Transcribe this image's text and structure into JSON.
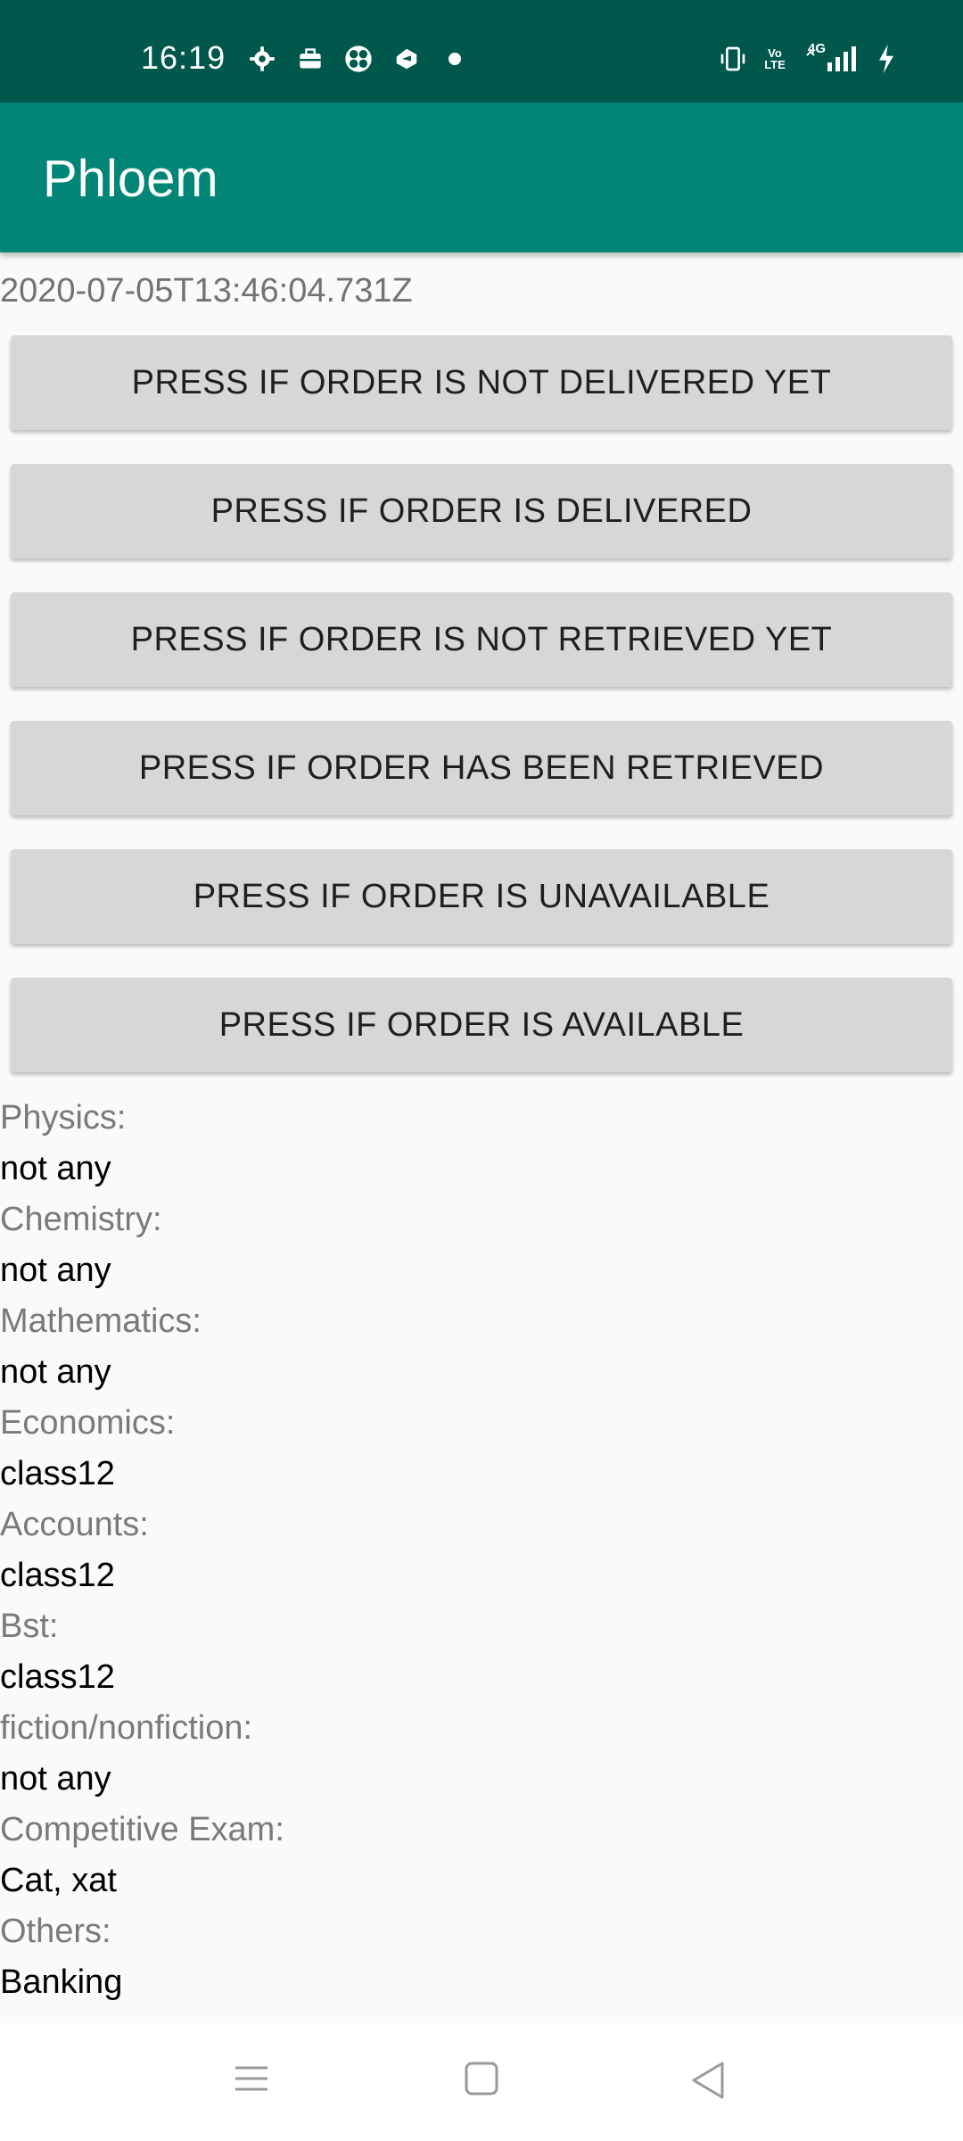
{
  "status_bar": {
    "time": "16:19",
    "left_icons": [
      "settings-icon",
      "briefcase-icon",
      "fan-icon",
      "drive-icon",
      "dot-icon"
    ],
    "right_icons": [
      "vibrate-icon",
      "volte-icon",
      "signal-4g-icon",
      "charging-icon"
    ],
    "volte_label": "Vo LTE",
    "network_label": "4G"
  },
  "app_bar": {
    "title": "Phloem"
  },
  "timestamp": "2020-07-05T13:46:04.731Z",
  "buttons": [
    {
      "label": "PRESS IF ORDER IS NOT DELIVERED YET"
    },
    {
      "label": "PRESS IF ORDER IS DELIVERED"
    },
    {
      "label": "PRESS IF ORDER IS NOT RETRIEVED YET"
    },
    {
      "label": "PRESS IF ORDER HAS BEEN RETRIEVED"
    },
    {
      "label": "PRESS IF ORDER IS UNAVAILABLE"
    },
    {
      "label": "PRESS IF ORDER IS AVAILABLE"
    }
  ],
  "fields": [
    {
      "label": "Physics:",
      "value": "not any"
    },
    {
      "label": "Chemistry:",
      "value": "not any"
    },
    {
      "label": "Mathematics:",
      "value": "not any"
    },
    {
      "label": "Economics:",
      "value": "class12"
    },
    {
      "label": "Accounts:",
      "value": "class12"
    },
    {
      "label": "Bst:",
      "value": "class12"
    },
    {
      "label": "fiction/nonfiction:",
      "value": "not any"
    },
    {
      "label": "Competitive Exam:",
      "value": "Cat, xat"
    },
    {
      "label": "Others:",
      "value": "Banking"
    }
  ],
  "nav_bar": {
    "icons": [
      "menu-icon",
      "home-square-icon",
      "back-triangle-icon"
    ]
  },
  "colors": {
    "status_bar": "#00574b",
    "app_bar": "#008577",
    "button_bg": "#d6d7d7",
    "background": "#fafafa"
  }
}
